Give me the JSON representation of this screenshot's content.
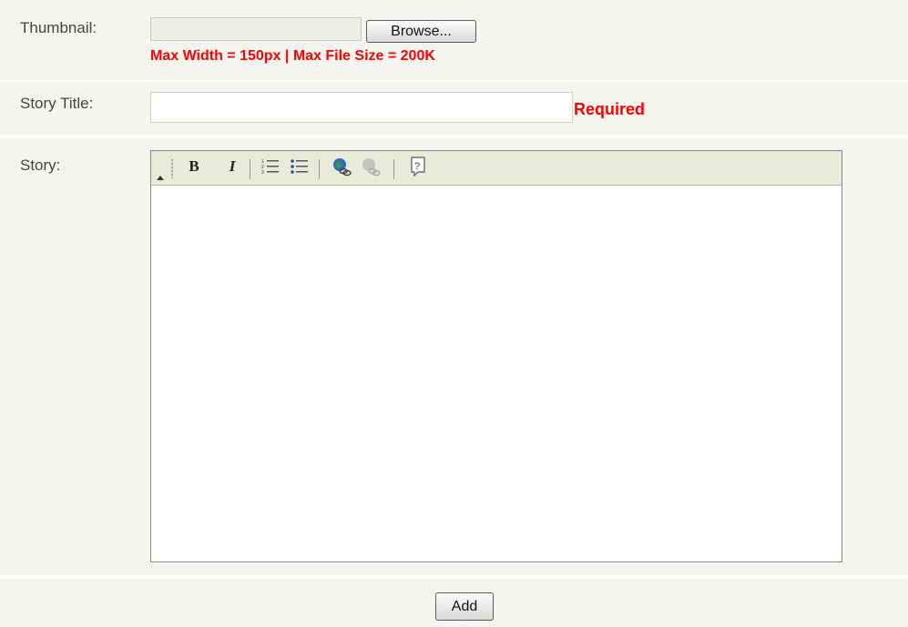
{
  "thumbnail": {
    "label": "Thumbnail:",
    "browse_label": "Browse...",
    "hint": "Max Width = 150px | Max File Size = 200K"
  },
  "story_title": {
    "label": "Story Title:",
    "value": "",
    "required_label": "Required"
  },
  "story": {
    "label": "Story:",
    "toolbar": {
      "bold_label": "B",
      "italic_label": "I",
      "icons": [
        "collapse-toolbar-icon",
        "bold-icon",
        "italic-icon",
        "ordered-list-icon",
        "unordered-list-icon",
        "insert-link-icon",
        "remove-link-icon",
        "help-icon"
      ]
    },
    "content": ""
  },
  "actions": {
    "add_label": "Add"
  },
  "colors": {
    "background": "#f6f4ee",
    "hint_red": "#ff0000",
    "toolbar_bg": "#e9ebd8"
  }
}
